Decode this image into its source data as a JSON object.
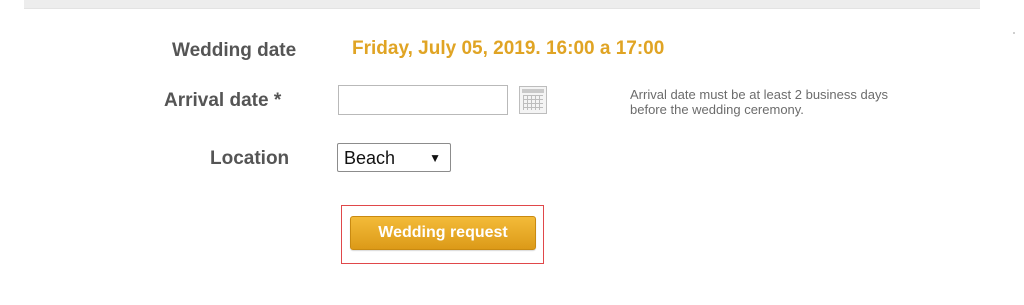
{
  "form": {
    "wedding_date": {
      "label": "Wedding date",
      "value": "Friday, July 05, 2019. 16:00 a 17:00"
    },
    "arrival_date": {
      "label": "Arrival date *",
      "value": "",
      "calendar_icon": "calendar-icon",
      "hint_line1": "Arrival date must be at least 2 business days",
      "hint_line2": "before the wedding ceremony."
    },
    "location": {
      "label": "Location",
      "selected": "Beach",
      "arrow_glyph": "▼"
    },
    "submit": {
      "label": "Wedding request"
    }
  },
  "colors": {
    "accent": "#e0a424",
    "button": "#e8a82a",
    "label_text": "#555555",
    "highlight_border": "#e0484a"
  }
}
